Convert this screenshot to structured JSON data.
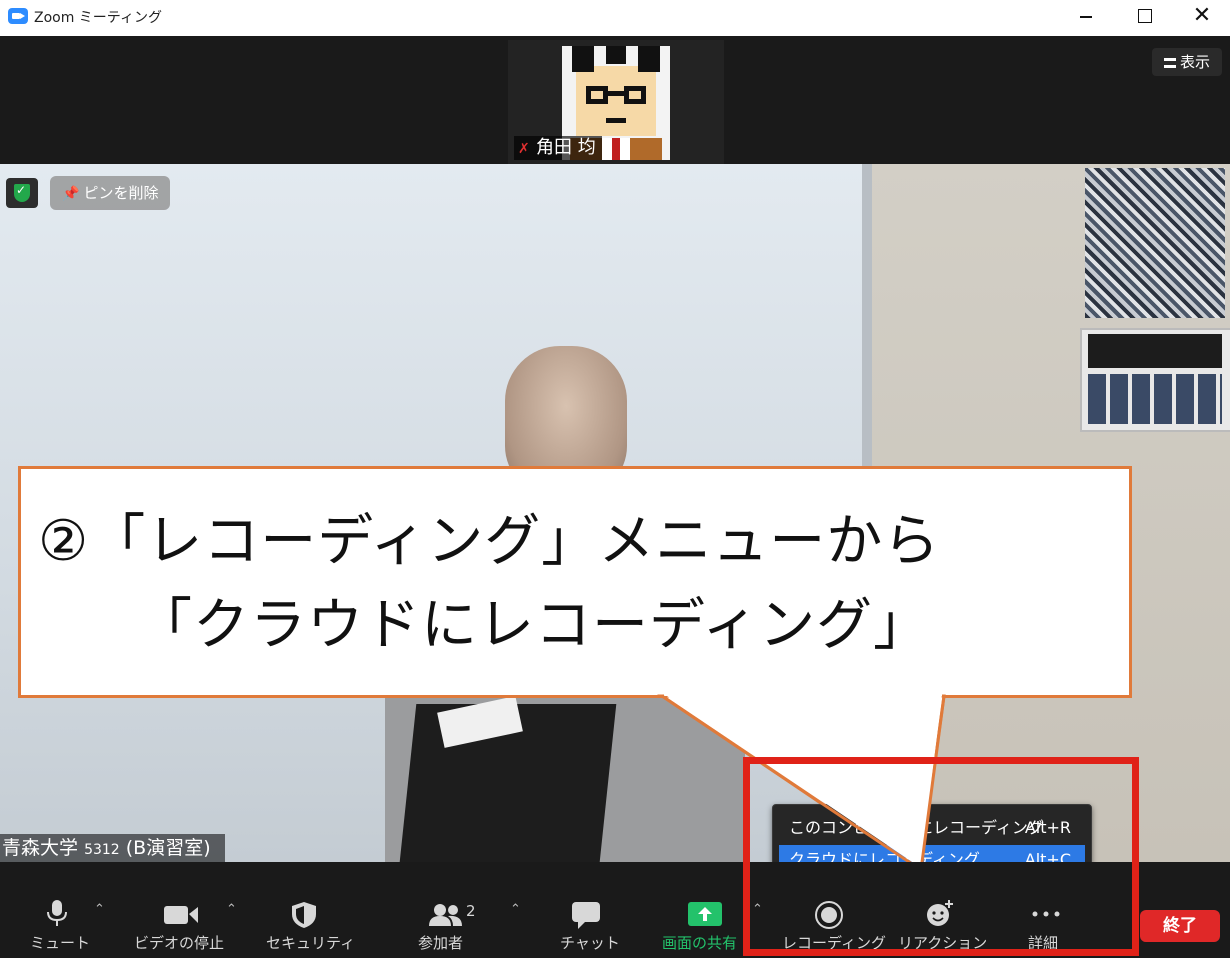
{
  "window": {
    "title": "Zoom ミーティング"
  },
  "thumbnail": {
    "participant_name": "角田 均"
  },
  "view_button": {
    "label": "表示"
  },
  "video": {
    "unpin_label": "ピンを削除",
    "room_label_main": "青森大学",
    "room_label_num": "5312",
    "room_label_room": "(B演習室)"
  },
  "callout": {
    "line1": "②「レコーディング」メニューから",
    "line2": "「クラウドにレコーディング」"
  },
  "recording_menu": {
    "items": [
      {
        "label": "このコンピュータにレコーディング",
        "shortcut": "Alt+R",
        "highlighted": false
      },
      {
        "label": "クラウドにレコーディング",
        "shortcut": "Alt+C",
        "highlighted": true
      }
    ]
  },
  "toolbar": {
    "mute": "ミュート",
    "stop_video": "ビデオの停止",
    "security": "セキュリティ",
    "participants": "参加者",
    "participants_count": "2",
    "chat": "チャット",
    "share_screen": "画面の共有",
    "recording": "レコーディング",
    "reactions": "リアクション",
    "more": "詳細",
    "end": "終了"
  },
  "colors": {
    "accent_blue": "#2d8cff",
    "menu_highlight": "#2d7ae5",
    "end_red": "#e02828",
    "share_green": "#23c26b",
    "callout_border": "#e07a3a",
    "highlight_red": "#e02218"
  }
}
